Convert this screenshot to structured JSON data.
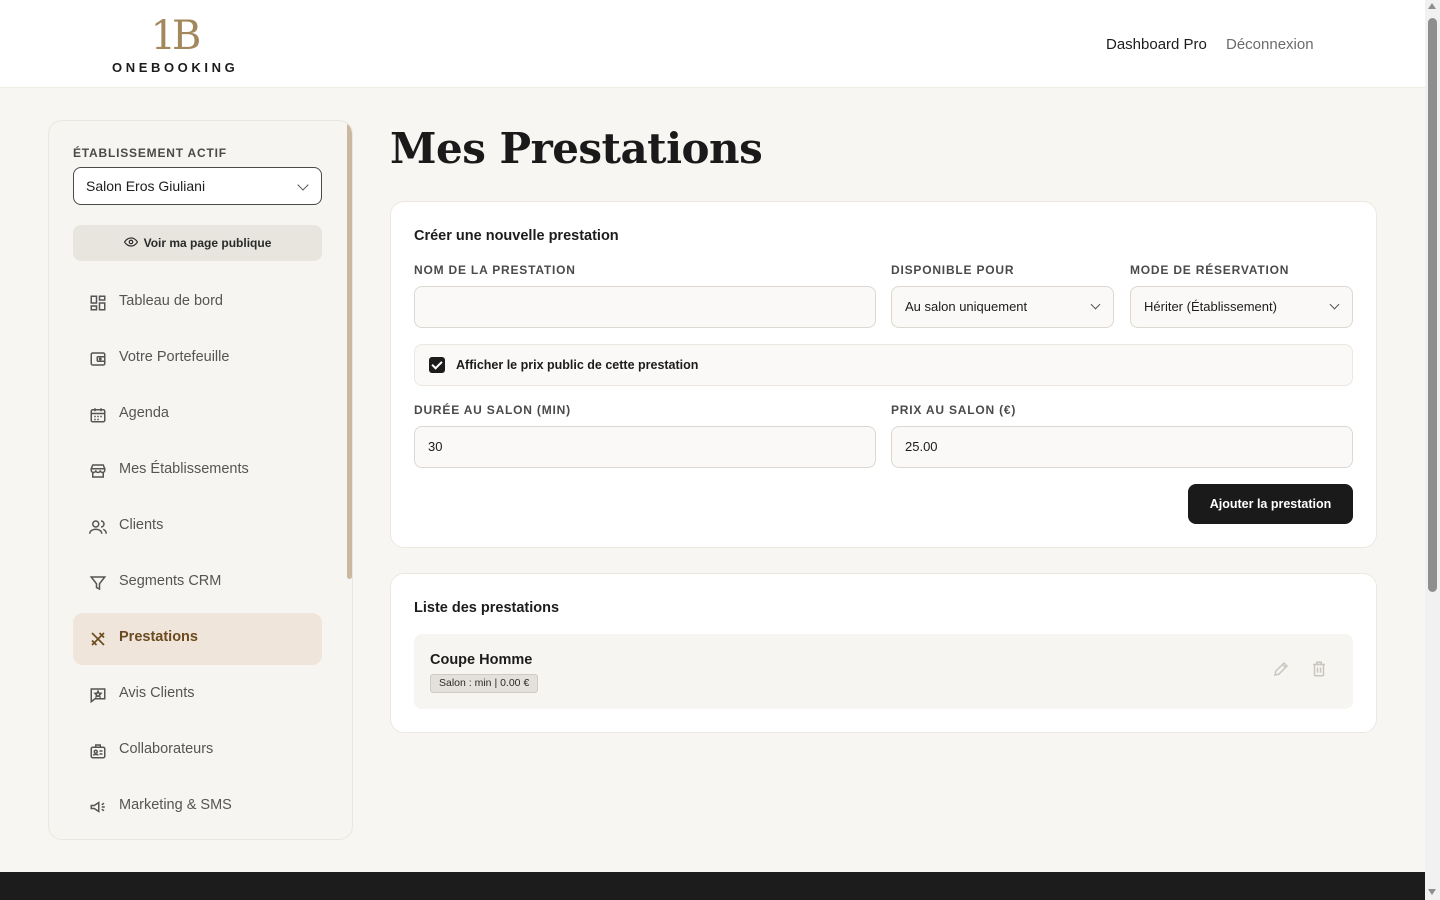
{
  "brand": {
    "mark": "1B",
    "name": "ONEBOOKING"
  },
  "header": {
    "dashboard_label": "Dashboard Pro",
    "logout_label": "Déconnexion"
  },
  "sidebar": {
    "active_label": "ÉTABLISSEMENT ACTIF",
    "selected_establishment": "Salon Eros Giuliani",
    "public_page_label": "Voir ma page publique",
    "items": [
      {
        "label": "Tableau de bord",
        "icon": "dashboard-icon"
      },
      {
        "label": "Votre Portefeuille",
        "icon": "wallet-icon"
      },
      {
        "label": "Agenda",
        "icon": "calendar-icon"
      },
      {
        "label": "Mes Établissements",
        "icon": "store-icon"
      },
      {
        "label": "Clients",
        "icon": "users-icon"
      },
      {
        "label": "Segments CRM",
        "icon": "filter-icon"
      },
      {
        "label": "Prestations",
        "icon": "tools-icon",
        "active": true
      },
      {
        "label": "Avis Clients",
        "icon": "review-icon"
      },
      {
        "label": "Collaborateurs",
        "icon": "badge-icon"
      },
      {
        "label": "Marketing & SMS",
        "icon": "megaphone-icon"
      }
    ]
  },
  "main": {
    "title": "Mes Prestations",
    "create": {
      "title": "Créer une nouvelle prestation",
      "name_label": "NOM DE LA PRESTATION",
      "name_value": "",
      "available_label": "DISPONIBLE POUR",
      "available_value": "Au salon uniquement",
      "mode_label": "MODE DE RÉSERVATION",
      "mode_value": "Hériter (Établissement)",
      "show_price_label": "Afficher le prix public de cette prestation",
      "show_price_checked": true,
      "duration_label": "DURÉE AU SALON (MIN)",
      "duration_value": "30",
      "price_label": "PRIX AU SALON (€)",
      "price_value": "25.00",
      "submit_label": "Ajouter la prestation"
    },
    "list": {
      "title": "Liste des prestations",
      "items": [
        {
          "name": "Coupe Homme",
          "badge": "Salon : min | 0.00 €"
        }
      ]
    }
  },
  "colors": {
    "accent": "#a3875d",
    "active_bg": "#efe5da",
    "dark": "#1a1a1a",
    "page_bg": "#f8f6f2"
  }
}
